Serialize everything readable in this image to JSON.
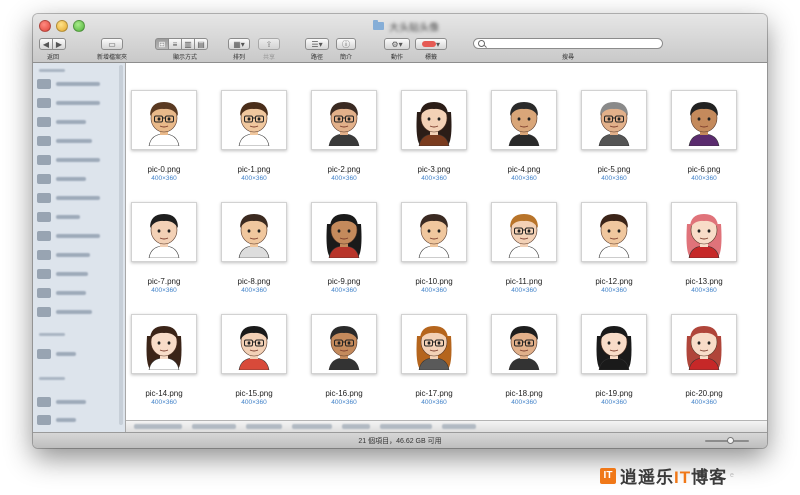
{
  "window": {
    "title": "大头贴头像",
    "traffic_lights": [
      "close",
      "minimize",
      "zoom"
    ]
  },
  "toolbar": {
    "back_label": "返回",
    "new_folder_label": "新增檔案夾",
    "view_label": "顯示方式",
    "arrange_label": "排列",
    "share_label": "共享",
    "path_label": "路徑",
    "info_label": "簡介",
    "action_label": "動作",
    "tags_label": "標籤",
    "search_label": "搜尋",
    "search_placeholder": ""
  },
  "sidebar": {
    "items": [
      {
        "label": "我的所有檔案",
        "icon": "all-files-icon"
      },
      {
        "label": "最近項目",
        "icon": "recents-icon"
      },
      {
        "label": "應用程式",
        "icon": "applications-icon"
      },
      {
        "label": "Weather",
        "icon": "folder-icon"
      },
      {
        "label": "桌面",
        "icon": "desktop-icon"
      },
      {
        "label": "文件",
        "icon": "documents-icon"
      },
      {
        "label": "下載項目",
        "icon": "downloads-icon"
      },
      {
        "label": "Dropbox",
        "icon": "dropbox-icon"
      },
      {
        "label": "AirDrop",
        "icon": "airdrop-icon"
      }
    ]
  },
  "files": [
    {
      "name": "pic-0.png",
      "dims": "400×360"
    },
    {
      "name": "pic-1.png",
      "dims": "400×360"
    },
    {
      "name": "pic-2.png",
      "dims": "400×360"
    },
    {
      "name": "pic-3.png",
      "dims": "400×360"
    },
    {
      "name": "pic-4.png",
      "dims": "400×360"
    },
    {
      "name": "pic-5.png",
      "dims": "400×360"
    },
    {
      "name": "pic-6.png",
      "dims": "400×360"
    },
    {
      "name": "pic-7.png",
      "dims": "400×360"
    },
    {
      "name": "pic-8.png",
      "dims": "400×360"
    },
    {
      "name": "pic-9.png",
      "dims": "400×360"
    },
    {
      "name": "pic-10.png",
      "dims": "400×360"
    },
    {
      "name": "pic-11.png",
      "dims": "400×360"
    },
    {
      "name": "pic-12.png",
      "dims": "400×360"
    },
    {
      "name": "pic-13.png",
      "dims": "400×360"
    },
    {
      "name": "pic-14.png",
      "dims": "400×360"
    },
    {
      "name": "pic-15.png",
      "dims": "400×360"
    },
    {
      "name": "pic-16.png",
      "dims": "400×360"
    },
    {
      "name": "pic-17.png",
      "dims": "400×360"
    },
    {
      "name": "pic-18.png",
      "dims": "400×360"
    },
    {
      "name": "pic-19.png",
      "dims": "400×360"
    },
    {
      "name": "pic-20.png",
      "dims": "400×360"
    }
  ],
  "status": {
    "text": "21 個項目，46.62 GB 可用"
  },
  "watermark": {
    "logo": "IT",
    "name_pre": "逍遥乐",
    "name_it": "IT",
    "name_post": "博客",
    "url": "e"
  },
  "colors": {
    "window_bg": "#e9e9e9",
    "sidebar_bg": "#dde4ec",
    "dims_text": "#3d7fc7",
    "watermark_accent": "#f07818"
  }
}
